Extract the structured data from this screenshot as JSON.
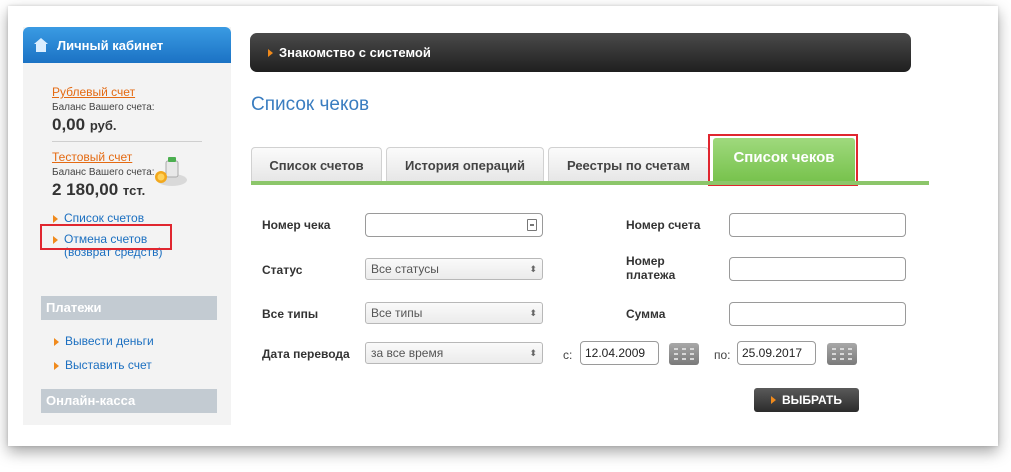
{
  "sidebar": {
    "header": "Личный кабинет",
    "rub_account": {
      "link": "Рублевый счет",
      "balance_label": "Баланс Вашего счета:",
      "balance": "0,00",
      "currency": "руб."
    },
    "test_account": {
      "link": "Тестовый счет",
      "balance_label": "Баланс Вашего счета:",
      "balance": "2 180,00",
      "currency": "тст."
    },
    "items": [
      "Список счетов",
      "Отмена счетов (возврат средств)"
    ],
    "payments_header": "Платежи",
    "payment_items": [
      "Вывести деньги",
      "Выставить счет"
    ],
    "kassa_header": "Онлайн-касса"
  },
  "topbar": {
    "label": "Знакомство с системой"
  },
  "page_title": "Список чеков",
  "tabs": [
    "Список счетов",
    "История операций",
    "Реестры по счетам",
    "Список чеков"
  ],
  "form": {
    "receipt_number": {
      "label": "Номер чека",
      "value": ""
    },
    "account_number": {
      "label": "Номер счета",
      "value": ""
    },
    "status": {
      "label": "Статус",
      "value": "Все статусы"
    },
    "payment_number": {
      "label_line1": "Номер",
      "label_line2": "платежа",
      "value": ""
    },
    "types": {
      "label": "Все типы",
      "value": "Все типы"
    },
    "amount": {
      "label": "Сумма",
      "value": ""
    },
    "transfer_date": {
      "label": "Дата перевода",
      "value": "за все время"
    },
    "from_label": "с:",
    "from_date": "12.04.2009",
    "to_label": "по:",
    "to_date": "25.09.2017",
    "submit": "ВЫБРАТЬ"
  },
  "colors": {
    "accent_blue": "#3a7dc0",
    "accent_green": "#8cc66a",
    "link_orange": "#e46a12",
    "highlight_red": "#e0262f"
  }
}
